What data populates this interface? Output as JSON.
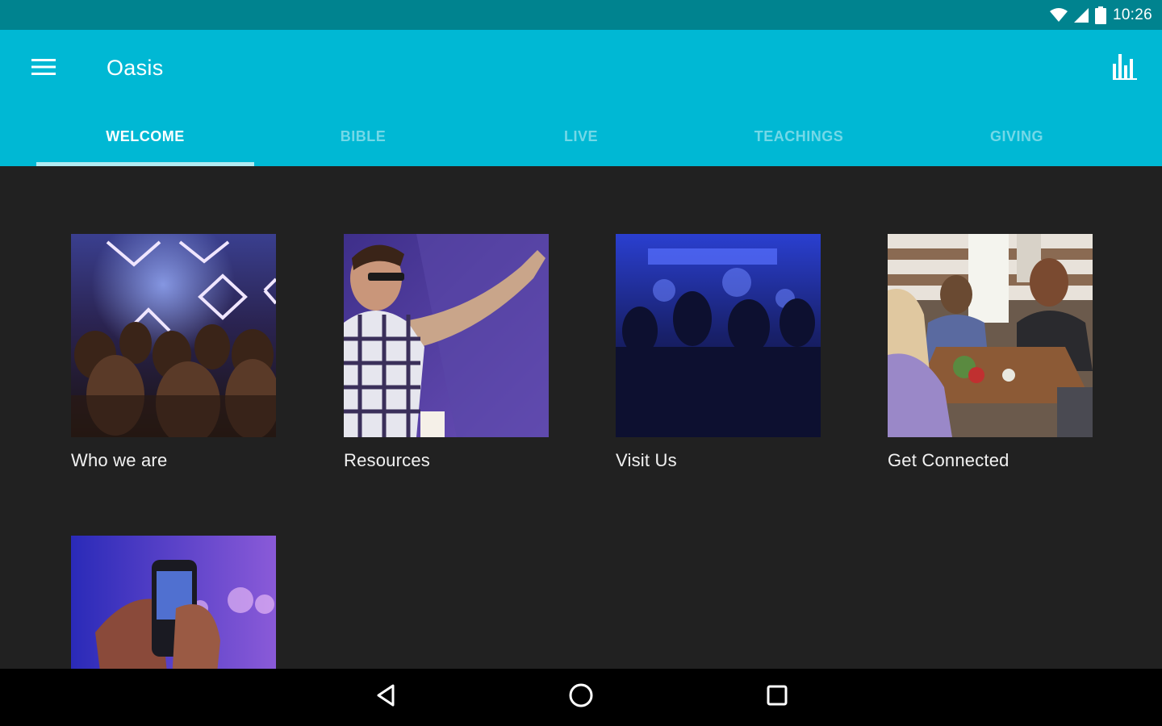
{
  "status_bar": {
    "time": "10:26"
  },
  "app_bar": {
    "title": "Oasis"
  },
  "tabs": [
    {
      "label": "WELCOME",
      "active": true
    },
    {
      "label": "BIBLE",
      "active": false
    },
    {
      "label": "LIVE",
      "active": false
    },
    {
      "label": "TEACHINGS",
      "active": false
    },
    {
      "label": "GIVING",
      "active": false
    }
  ],
  "cards": [
    {
      "label": "Who we are"
    },
    {
      "label": "Resources"
    },
    {
      "label": "Visit Us"
    },
    {
      "label": "Get Connected"
    },
    {
      "label": ""
    }
  ],
  "icons": {
    "menu": "hamburger-menu-icon",
    "stats": "bar-chart-icon",
    "wifi": "wifi-icon",
    "signal": "cellular-signal-icon",
    "battery": "battery-icon",
    "back": "back-triangle-icon",
    "home": "home-circle-icon",
    "recents": "recents-square-icon"
  },
  "colors": {
    "status_bar": "#00838f",
    "app_bar": "#00b8d4",
    "background": "#212121",
    "tab_indicator": "#b2ebf2"
  }
}
